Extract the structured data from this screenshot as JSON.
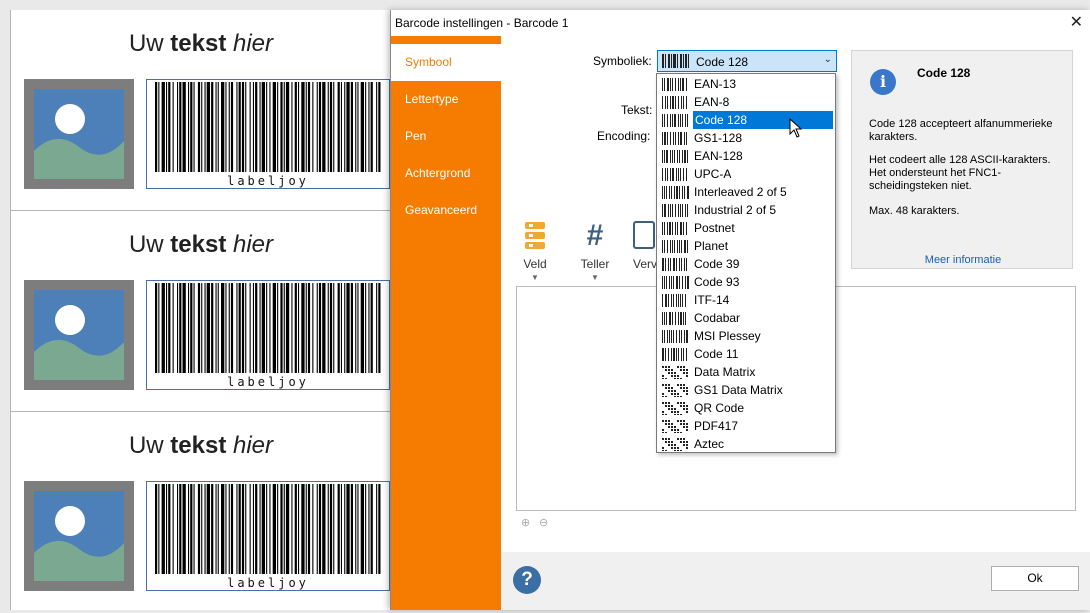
{
  "labels": [
    {
      "title_pre": "Uw ",
      "title_bold": "tekst",
      "title_italic": "hier",
      "barcode_text": "labeljoy"
    },
    {
      "title_pre": "Uw ",
      "title_bold": "tekst",
      "title_italic": "hier",
      "barcode_text": "labeljoy"
    },
    {
      "title_pre": "Uw ",
      "title_bold": "tekst",
      "title_italic": "hier",
      "barcode_text": "labeljoy"
    }
  ],
  "dialog": {
    "title": "Barcode instellingen - Barcode 1",
    "close_glyph": "✕",
    "nav": [
      {
        "label": "Symbool",
        "active": true
      },
      {
        "label": "Lettertype",
        "active": false
      },
      {
        "label": "Pen",
        "active": false
      },
      {
        "label": "Achtergrond",
        "active": false
      },
      {
        "label": "Geavanceerd",
        "active": false
      }
    ],
    "symbology_label": "Symboliek:",
    "symbology_value": "Code 128",
    "text_label": "Tekst:",
    "encoding_label": "Encoding:",
    "tools": [
      {
        "label": "Veld",
        "icon": "field-icon"
      },
      {
        "label": "Teller",
        "icon": "hash-icon"
      },
      {
        "label": "Vervang",
        "icon": "replace-icon"
      }
    ],
    "info": {
      "heading": "Code 128",
      "p1": "Code 128 accepteert alfanummerieke karakters.",
      "p2": "Het codeert alle 128 ASCII-karakters. Het ondersteunt het FNC1-scheidingsteken niet.",
      "p3": "Max. 48 karakters.",
      "more_link": "Meer informatie"
    },
    "help_glyph": "?",
    "ok_label": "Ok"
  },
  "dropdown": {
    "selected": "Code 128",
    "options": [
      "EAN-13",
      "EAN-8",
      "Code 128",
      "GS1-128",
      "EAN-128",
      "UPC-A",
      "Interleaved 2 of 5",
      "Industrial 2 of 5",
      "Postnet",
      "Planet",
      "Code 39",
      "Code 93",
      "ITF-14",
      "Codabar",
      "MSI Plessey",
      "Code 11",
      "Data Matrix",
      "GS1 Data Matrix",
      "QR Code",
      "PDF417",
      "Aztec"
    ]
  },
  "colors": {
    "accent": "#f57c00",
    "selection": "#0078d7",
    "link": "#1a5fb4"
  }
}
